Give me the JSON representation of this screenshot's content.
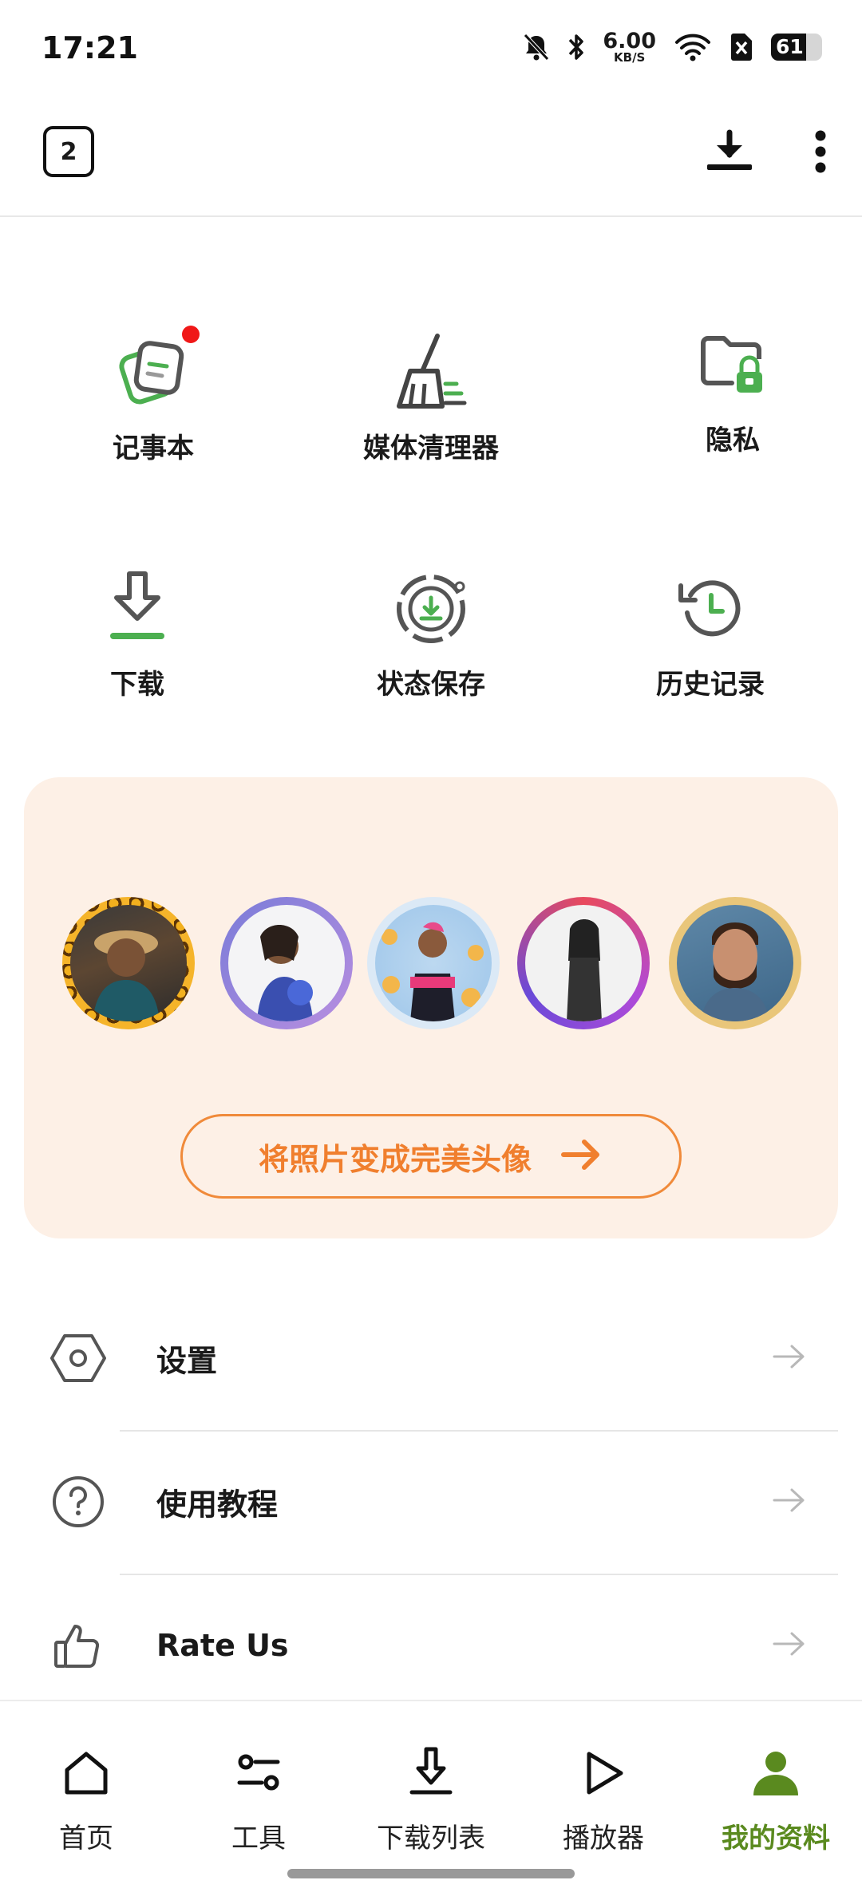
{
  "status_bar": {
    "time": "17:21",
    "net_speed_value": "6.00",
    "net_speed_unit": "KB/S",
    "battery_level": "61",
    "icons": [
      "bell-off-icon",
      "bluetooth-icon",
      "wifi-icon",
      "sim-off-icon",
      "battery-icon"
    ]
  },
  "app_bar": {
    "tab_count": "2",
    "actions": [
      "download-icon",
      "more-vertical-icon"
    ]
  },
  "tools": [
    {
      "label": "记事本",
      "icon": "notepad-icon",
      "badge": true
    },
    {
      "label": "媒体清理器",
      "icon": "broom-icon"
    },
    {
      "label": "隐私",
      "icon": "private-folder-icon"
    },
    {
      "label": "下载",
      "icon": "download-icon"
    },
    {
      "label": "状态保存",
      "icon": "status-saver-icon"
    },
    {
      "label": "历史记录",
      "icon": "history-icon"
    }
  ],
  "promo": {
    "button_label": "将照片变成完美头像",
    "avatar_count": 5,
    "colors": {
      "bg": "#fdf0e6",
      "accent": "#f07f2e"
    }
  },
  "settings_list": [
    {
      "label": "设置",
      "icon": "settings-hexagon-icon"
    },
    {
      "label": "使用教程",
      "icon": "help-circle-icon"
    },
    {
      "label": "Rate Us",
      "icon": "thumbs-up-icon"
    }
  ],
  "bottom_nav": [
    {
      "label": "首页",
      "icon": "home-icon"
    },
    {
      "label": "工具",
      "icon": "tools-icon"
    },
    {
      "label": "下载列表",
      "icon": "download-list-icon"
    },
    {
      "label": "播放器",
      "icon": "play-icon"
    },
    {
      "label": "我的资料",
      "icon": "profile-icon",
      "active": true
    }
  ],
  "colors": {
    "active_nav": "#5a8a1f",
    "icon_green": "#4caf50"
  }
}
